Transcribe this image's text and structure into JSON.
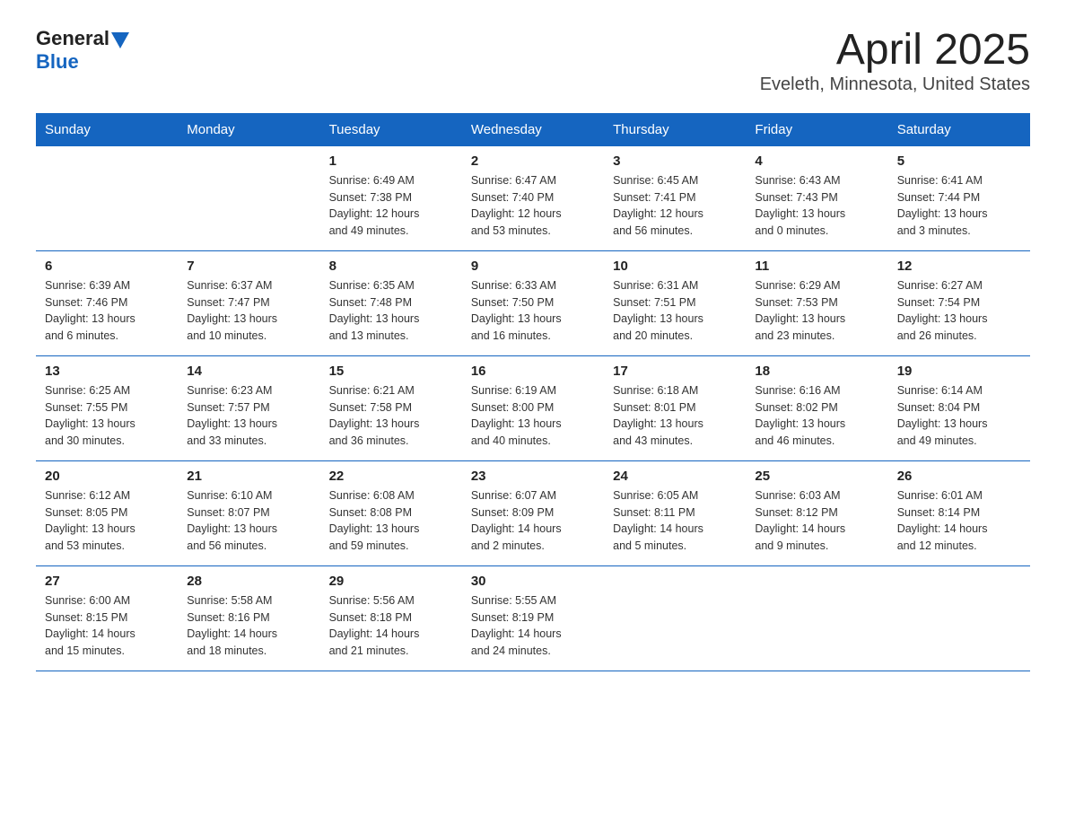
{
  "header": {
    "logo_general": "General",
    "logo_blue": "Blue",
    "title": "April 2025",
    "subtitle": "Eveleth, Minnesota, United States"
  },
  "days_of_week": [
    "Sunday",
    "Monday",
    "Tuesday",
    "Wednesday",
    "Thursday",
    "Friday",
    "Saturday"
  ],
  "weeks": [
    [
      {
        "day": "",
        "info": ""
      },
      {
        "day": "",
        "info": ""
      },
      {
        "day": "1",
        "info": "Sunrise: 6:49 AM\nSunset: 7:38 PM\nDaylight: 12 hours\nand 49 minutes."
      },
      {
        "day": "2",
        "info": "Sunrise: 6:47 AM\nSunset: 7:40 PM\nDaylight: 12 hours\nand 53 minutes."
      },
      {
        "day": "3",
        "info": "Sunrise: 6:45 AM\nSunset: 7:41 PM\nDaylight: 12 hours\nand 56 minutes."
      },
      {
        "day": "4",
        "info": "Sunrise: 6:43 AM\nSunset: 7:43 PM\nDaylight: 13 hours\nand 0 minutes."
      },
      {
        "day": "5",
        "info": "Sunrise: 6:41 AM\nSunset: 7:44 PM\nDaylight: 13 hours\nand 3 minutes."
      }
    ],
    [
      {
        "day": "6",
        "info": "Sunrise: 6:39 AM\nSunset: 7:46 PM\nDaylight: 13 hours\nand 6 minutes."
      },
      {
        "day": "7",
        "info": "Sunrise: 6:37 AM\nSunset: 7:47 PM\nDaylight: 13 hours\nand 10 minutes."
      },
      {
        "day": "8",
        "info": "Sunrise: 6:35 AM\nSunset: 7:48 PM\nDaylight: 13 hours\nand 13 minutes."
      },
      {
        "day": "9",
        "info": "Sunrise: 6:33 AM\nSunset: 7:50 PM\nDaylight: 13 hours\nand 16 minutes."
      },
      {
        "day": "10",
        "info": "Sunrise: 6:31 AM\nSunset: 7:51 PM\nDaylight: 13 hours\nand 20 minutes."
      },
      {
        "day": "11",
        "info": "Sunrise: 6:29 AM\nSunset: 7:53 PM\nDaylight: 13 hours\nand 23 minutes."
      },
      {
        "day": "12",
        "info": "Sunrise: 6:27 AM\nSunset: 7:54 PM\nDaylight: 13 hours\nand 26 minutes."
      }
    ],
    [
      {
        "day": "13",
        "info": "Sunrise: 6:25 AM\nSunset: 7:55 PM\nDaylight: 13 hours\nand 30 minutes."
      },
      {
        "day": "14",
        "info": "Sunrise: 6:23 AM\nSunset: 7:57 PM\nDaylight: 13 hours\nand 33 minutes."
      },
      {
        "day": "15",
        "info": "Sunrise: 6:21 AM\nSunset: 7:58 PM\nDaylight: 13 hours\nand 36 minutes."
      },
      {
        "day": "16",
        "info": "Sunrise: 6:19 AM\nSunset: 8:00 PM\nDaylight: 13 hours\nand 40 minutes."
      },
      {
        "day": "17",
        "info": "Sunrise: 6:18 AM\nSunset: 8:01 PM\nDaylight: 13 hours\nand 43 minutes."
      },
      {
        "day": "18",
        "info": "Sunrise: 6:16 AM\nSunset: 8:02 PM\nDaylight: 13 hours\nand 46 minutes."
      },
      {
        "day": "19",
        "info": "Sunrise: 6:14 AM\nSunset: 8:04 PM\nDaylight: 13 hours\nand 49 minutes."
      }
    ],
    [
      {
        "day": "20",
        "info": "Sunrise: 6:12 AM\nSunset: 8:05 PM\nDaylight: 13 hours\nand 53 minutes."
      },
      {
        "day": "21",
        "info": "Sunrise: 6:10 AM\nSunset: 8:07 PM\nDaylight: 13 hours\nand 56 minutes."
      },
      {
        "day": "22",
        "info": "Sunrise: 6:08 AM\nSunset: 8:08 PM\nDaylight: 13 hours\nand 59 minutes."
      },
      {
        "day": "23",
        "info": "Sunrise: 6:07 AM\nSunset: 8:09 PM\nDaylight: 14 hours\nand 2 minutes."
      },
      {
        "day": "24",
        "info": "Sunrise: 6:05 AM\nSunset: 8:11 PM\nDaylight: 14 hours\nand 5 minutes."
      },
      {
        "day": "25",
        "info": "Sunrise: 6:03 AM\nSunset: 8:12 PM\nDaylight: 14 hours\nand 9 minutes."
      },
      {
        "day": "26",
        "info": "Sunrise: 6:01 AM\nSunset: 8:14 PM\nDaylight: 14 hours\nand 12 minutes."
      }
    ],
    [
      {
        "day": "27",
        "info": "Sunrise: 6:00 AM\nSunset: 8:15 PM\nDaylight: 14 hours\nand 15 minutes."
      },
      {
        "day": "28",
        "info": "Sunrise: 5:58 AM\nSunset: 8:16 PM\nDaylight: 14 hours\nand 18 minutes."
      },
      {
        "day": "29",
        "info": "Sunrise: 5:56 AM\nSunset: 8:18 PM\nDaylight: 14 hours\nand 21 minutes."
      },
      {
        "day": "30",
        "info": "Sunrise: 5:55 AM\nSunset: 8:19 PM\nDaylight: 14 hours\nand 24 minutes."
      },
      {
        "day": "",
        "info": ""
      },
      {
        "day": "",
        "info": ""
      },
      {
        "day": "",
        "info": ""
      }
    ]
  ]
}
